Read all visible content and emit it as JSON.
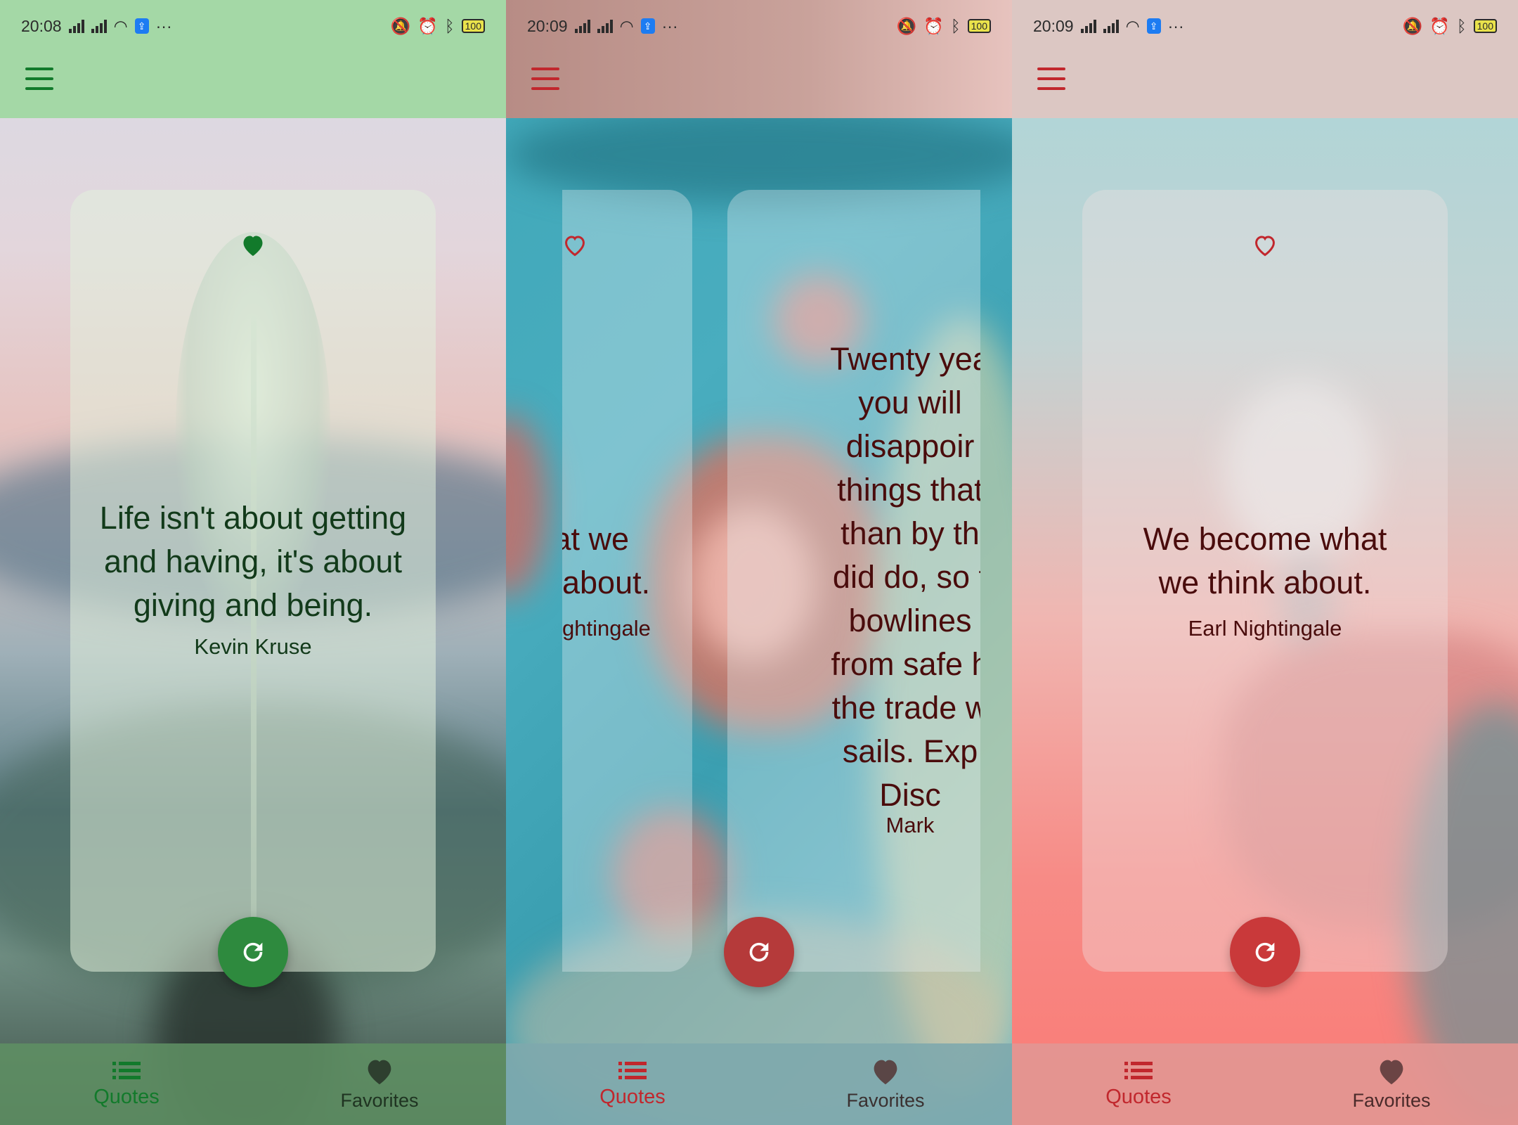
{
  "screens": [
    {
      "status": {
        "time": "20:08",
        "battery": "100",
        "more": "···",
        "chip": "⇪"
      },
      "quote": {
        "text": "Life isn't about getting and having, it's about giving and being.",
        "author": "Kevin Kruse",
        "favorited": true
      },
      "colors": {
        "accent": "#127a2b",
        "appbar": "#a4d8a6",
        "nav": "#5f8f63",
        "fab": "#2e8a3e",
        "text": "#123a1a"
      },
      "nav": {
        "quotes_label": "Quotes",
        "favorites_label": "Favorites"
      }
    },
    {
      "status": {
        "time": "20:09",
        "battery": "100",
        "more": "···",
        "chip": "⇪"
      },
      "cards": [
        {
          "lines": [
            "ne what we",
            "about."
          ],
          "author": "ghtingale"
        },
        {
          "lines": [
            "Twenty yea",
            "you will",
            "disappoir",
            "things that",
            "than by th",
            "did do, so t",
            "bowlines",
            "from safe h",
            "the trade w",
            "sails.  Exp",
            "Disc"
          ],
          "author": "Mark"
        }
      ],
      "colors": {
        "accent": "#c1272d",
        "nav": "#7ea8ad",
        "fab": "#b53a3a",
        "text": "#4a0c0c"
      },
      "nav": {
        "quotes_label": "Quotes",
        "favorites_label": "Favorites"
      }
    },
    {
      "status": {
        "time": "20:09",
        "battery": "100",
        "more": "···",
        "chip": "⇪"
      },
      "quote": {
        "text": "We become what we think about.",
        "author": "Earl Nightingale",
        "favorited": false
      },
      "colors": {
        "accent": "#c1272d",
        "appbar": "#dcc7c3",
        "nav": "#e29692",
        "fab": "#c9393a",
        "text": "#4a0c0c"
      },
      "nav": {
        "quotes_label": "Quotes",
        "favorites_label": "Favorites"
      }
    }
  ]
}
